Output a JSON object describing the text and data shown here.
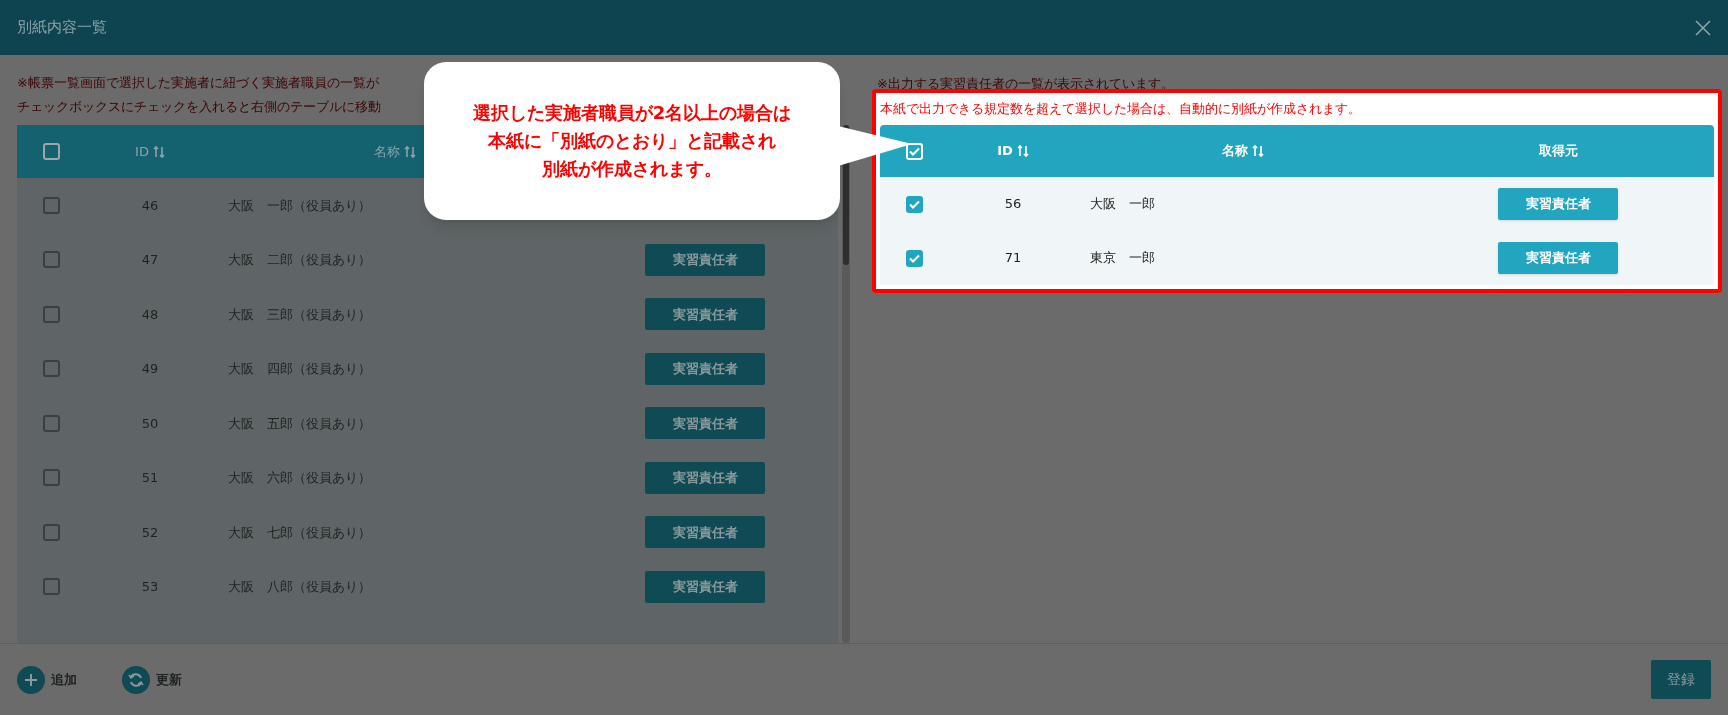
{
  "dialog": {
    "title": "別紙内容一覧"
  },
  "left_panel": {
    "notes": [
      "※帳票一覧画面で選択した実施者に紐づく実施者職員の一覧が",
      "チェックボックスにチェックを入れると右側のテーブルに移動"
    ],
    "table": {
      "columns": [
        "ID",
        "名称"
      ],
      "select_all": {
        "checked": false
      },
      "rows": [
        {
          "id": "46",
          "name": "大阪　一郎（役員あり）",
          "checked": false
        },
        {
          "id": "47",
          "name": "大阪　二郎（役員あり）",
          "checked": false,
          "source": "実習責任者"
        },
        {
          "id": "48",
          "name": "大阪　三郎（役員あり）",
          "checked": false,
          "source": "実習責任者"
        },
        {
          "id": "49",
          "name": "大阪　四郎（役員あり）",
          "checked": false,
          "source": "実習責任者"
        },
        {
          "id": "50",
          "name": "大阪　五郎（役員あり）",
          "checked": false,
          "source": "実習責任者"
        },
        {
          "id": "51",
          "name": "大阪　六郎（役員あり）",
          "checked": false,
          "source": "実習責任者"
        },
        {
          "id": "52",
          "name": "大阪　七郎（役員あり）",
          "checked": false,
          "source": "実習責任者"
        },
        {
          "id": "53",
          "name": "大阪　八郎（役員あり）",
          "checked": false,
          "source": "実習責任者"
        }
      ]
    }
  },
  "right_panel": {
    "note": "※出力する実習責任者の一覧が表示されています。",
    "highlight_note": "本紙で出力できる規定数を超えて選択した場合は、自動的に別紙が作成されます。",
    "table": {
      "columns": [
        "ID",
        "名称",
        "取得元"
      ],
      "select_all": {
        "checked": true
      },
      "rows": [
        {
          "id": "56",
          "name": "大阪　一郎",
          "checked": true,
          "source": "実習責任者"
        },
        {
          "id": "71",
          "name": "東京　一郎",
          "checked": true,
          "source": "実習責任者"
        }
      ]
    }
  },
  "callout": {
    "lines": [
      "選択した実施者職員が2名以上の場合は",
      "本紙に「別紙のとおり」と記載され",
      "別紙が作成されます。"
    ]
  },
  "footer": {
    "actions": [
      {
        "label": "追加",
        "kind": "add"
      },
      {
        "label": "更新",
        "kind": "refresh"
      }
    ],
    "submit": "登録"
  }
}
